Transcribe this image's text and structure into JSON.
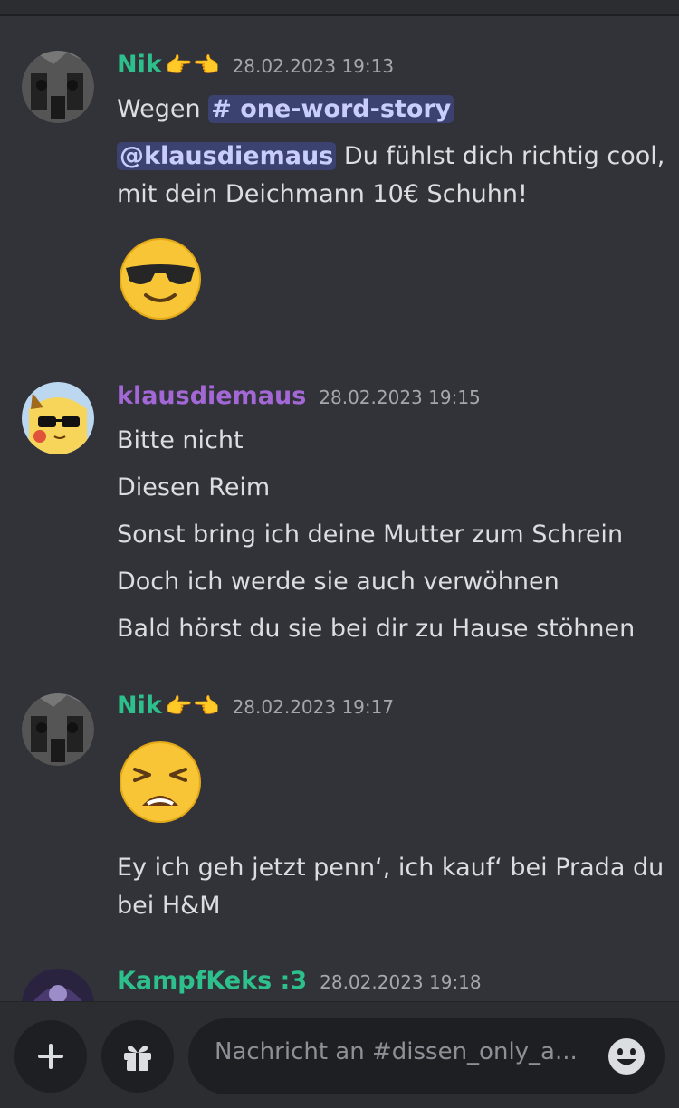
{
  "messages": [
    {
      "author": "Nik",
      "author_emojis": "👉👈",
      "timestamp": "28.02.2023 19:13",
      "line1_prefix": "Wegen",
      "channel_mention": "# one-word-story",
      "user_mention": "@klausdiemaus",
      "line2_rest": " Du fühlst dich richtig cool,",
      "line3": "mit dein Deichmann 10€ Schuhn!",
      "emoji": "smiling-face-with-sunglasses"
    },
    {
      "author": "klausdiemaus",
      "timestamp": "28.02.2023 19:15",
      "lines": [
        "Bitte nicht",
        "Diesen Reim",
        "Sonst bring ich deine Mutter zum Schrein",
        "Doch ich werde sie auch verwöhnen",
        "Bald hörst du sie bei dir zu Hause stöhnen"
      ]
    },
    {
      "author": "Nik",
      "author_emojis": "👉👈",
      "timestamp": "28.02.2023 19:17",
      "emoji": "weary-face",
      "line1": "Ey ich geh jetzt penn‘, ich kauf‘ bei Prada du",
      "line2": "bei H&M"
    },
    {
      "author": "KampfKeks :3",
      "timestamp": "28.02.2023 19:18"
    }
  ],
  "composer": {
    "placeholder": "Nachricht an #dissen_only_a...",
    "add_icon": "plus-icon",
    "gift_icon": "gift-icon",
    "emoji_icon": "emoji-icon"
  },
  "colors": {
    "background": "#313338",
    "author_green": "#2dc08c",
    "author_purple": "#a367d6",
    "mention_bg": "#3c4270",
    "mention_text": "#c9cdfb"
  }
}
